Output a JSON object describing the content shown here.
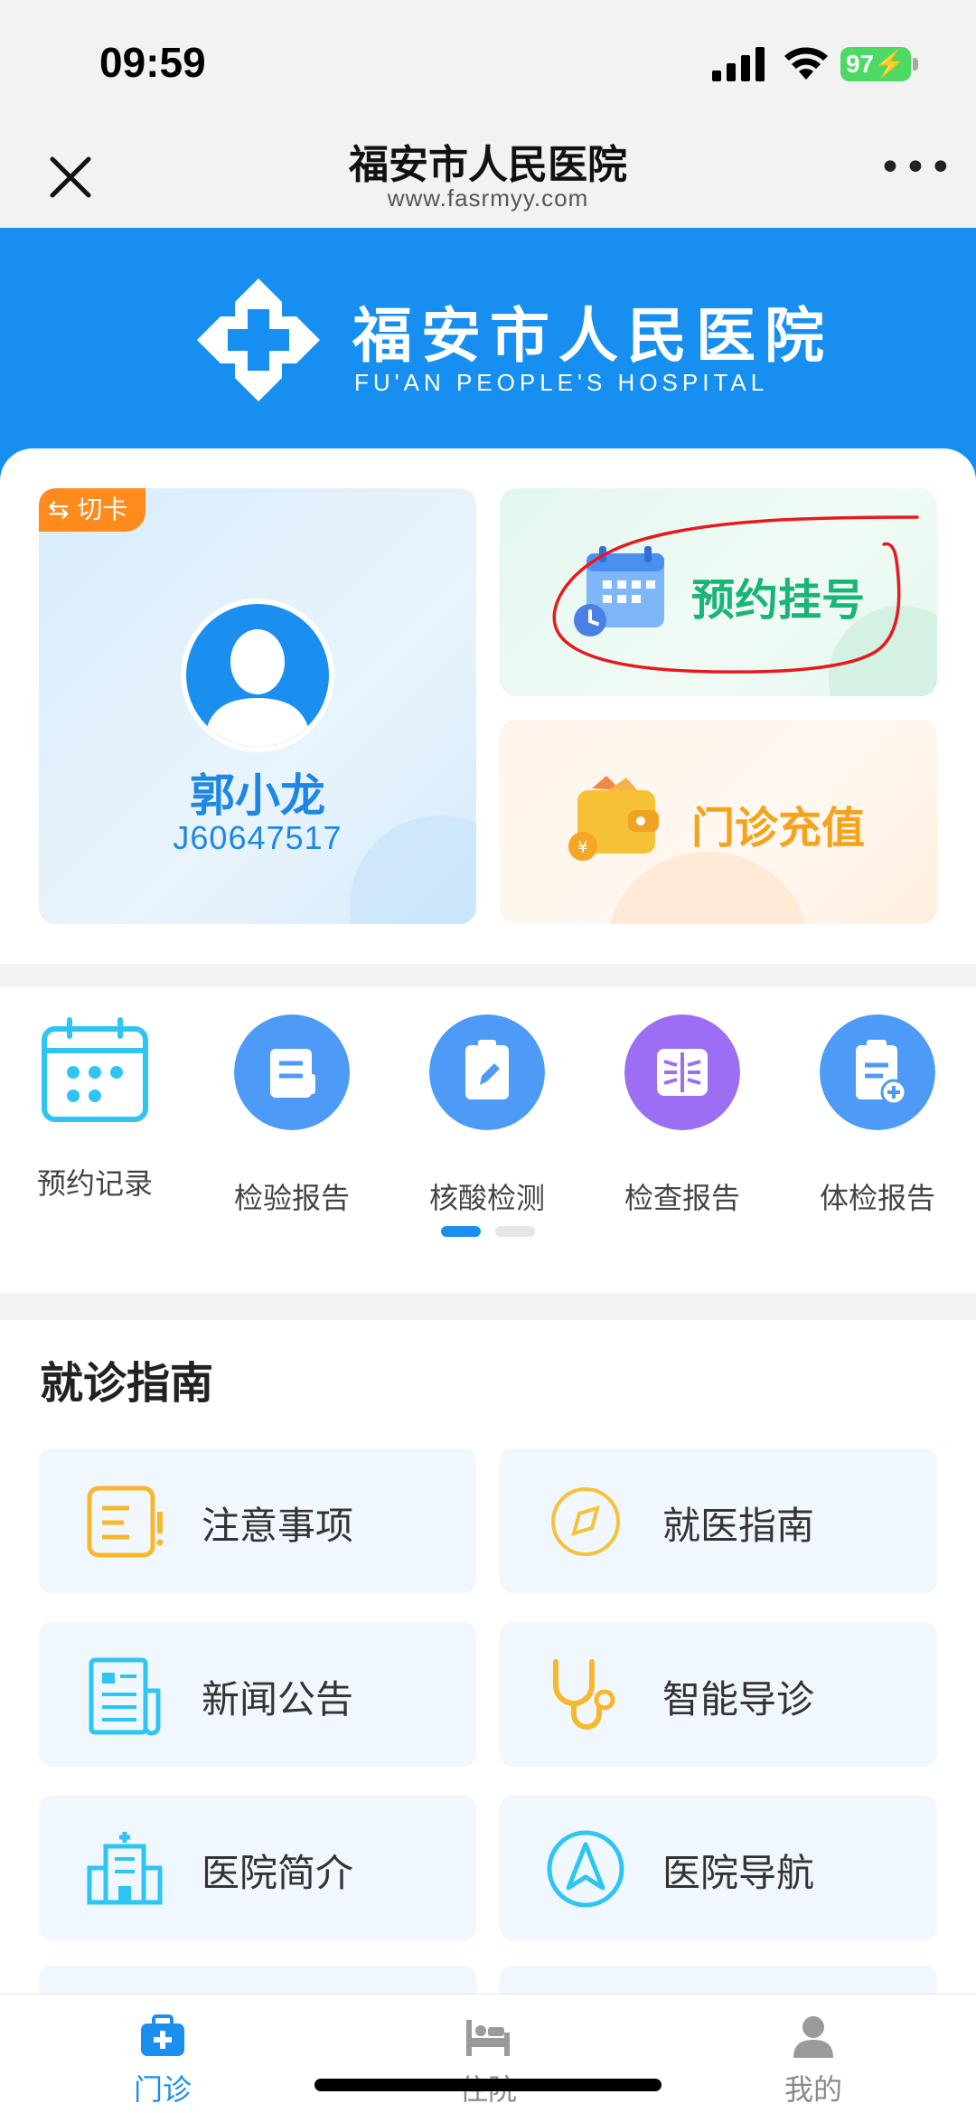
{
  "status_bar": {
    "time": "09:59",
    "battery": "97"
  },
  "nav": {
    "title": "福安市人民医院",
    "subtitle": "www.fasrmyy.com",
    "more": "•••"
  },
  "banner": {
    "name_cn": "福安市人民医院",
    "name_en": "FU'AN PEOPLE'S HOSPITAL"
  },
  "patient": {
    "switch_label": "切卡",
    "name": "郭小龙",
    "id": "J60647517"
  },
  "actions": {
    "appointment": "预约挂号",
    "recharge": "门诊充值"
  },
  "quick_functions": [
    {
      "label": "预约记录",
      "icon": "calendar-icon",
      "color": "#2ec5f3"
    },
    {
      "label": "检验报告",
      "icon": "report-scroll-icon",
      "color": "#4d9bf7"
    },
    {
      "label": "核酸检测",
      "icon": "clipboard-pen-icon",
      "color": "#4d9bf7"
    },
    {
      "label": "检查报告",
      "icon": "scan-icon",
      "color": "#9b6ef3"
    },
    {
      "label": "体检报告",
      "icon": "clipboard-plus-icon",
      "color": "#4d9bf7"
    }
  ],
  "guide": {
    "title": "就诊指南",
    "items": [
      {
        "label": "注意事项",
        "icon": "notice-icon"
      },
      {
        "label": "就医指南",
        "icon": "compass-icon"
      },
      {
        "label": "新闻公告",
        "icon": "news-icon"
      },
      {
        "label": "智能导诊",
        "icon": "stethoscope-icon"
      },
      {
        "label": "医院简介",
        "icon": "hospital-building-icon"
      },
      {
        "label": "医院导航",
        "icon": "navigation-icon"
      }
    ]
  },
  "tabs": [
    {
      "label": "门诊",
      "icon": "medical-kit-icon",
      "active": true
    },
    {
      "label": "住院",
      "icon": "bed-icon",
      "active": false
    },
    {
      "label": "我的",
      "icon": "user-icon",
      "active": false
    }
  ],
  "colors": {
    "brand": "#168ff0",
    "green": "#19b477",
    "orange": "#f5a31d",
    "active_tab": "#1a8ff0",
    "inactive_tab": "#8a8a8a"
  }
}
